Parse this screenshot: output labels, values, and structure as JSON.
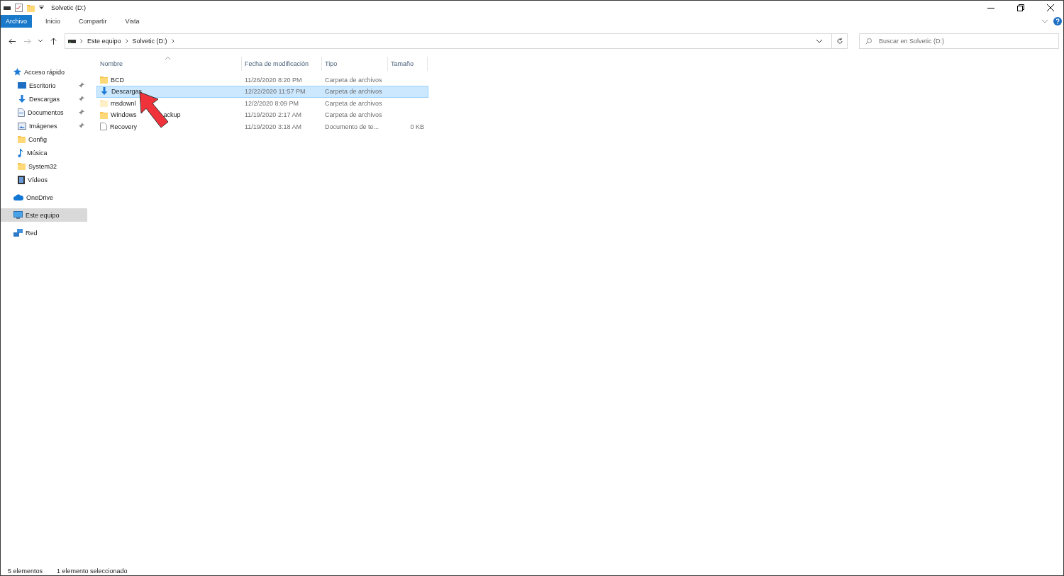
{
  "window": {
    "title": "Solvetic (D:)"
  },
  "ribbon_tabs": [
    {
      "label": "Archivo",
      "selected": true
    },
    {
      "label": "Inicio",
      "selected": false
    },
    {
      "label": "Compartir",
      "selected": false
    },
    {
      "label": "Vista",
      "selected": false
    }
  ],
  "address": {
    "path": [
      "Este equipo",
      "Solvetic (D:)"
    ]
  },
  "search": {
    "placeholder": "Buscar en Solvetic (D:)"
  },
  "sidebar": {
    "items": [
      {
        "label": "Acceso rápido",
        "selected": false,
        "children": [
          {
            "label": "Escritorio",
            "pinned": true
          },
          {
            "label": "Descargas",
            "pinned": true
          },
          {
            "label": "Documentos",
            "pinned": true
          },
          {
            "label": "Imágenes",
            "pinned": true
          },
          {
            "label": "Config",
            "pinned": false
          },
          {
            "label": "Música",
            "pinned": false
          },
          {
            "label": "System32",
            "pinned": false
          },
          {
            "label": "Vídeos",
            "pinned": false
          }
        ]
      },
      {
        "label": "OneDrive",
        "selected": false
      },
      {
        "label": "Este equipo",
        "selected": true
      },
      {
        "label": "Red",
        "selected": false
      }
    ]
  },
  "table": {
    "columns": [
      "Nombre",
      "Fecha de modificación",
      "Tipo",
      "Tamaño"
    ],
    "rows": [
      {
        "kind": "folder",
        "name": "BCD",
        "date": "11/26/2020 8:20 PM",
        "type": "Carpeta de archivos",
        "selected": false,
        "hidden": false
      },
      {
        "kind": "downloads",
        "name": "Descargas",
        "date": "12/22/2020 11:57 PM",
        "type": "Carpeta de archivos",
        "selected": true,
        "hidden": false
      },
      {
        "kind": "folder",
        "name": "msdownl",
        "date": "12/2/2020 8:09 PM",
        "type": "Carpeta de archivos",
        "selected": false,
        "hidden": true
      },
      {
        "kind": "folder",
        "name": "Windows",
        "name_tail": "ackup",
        "date": "11/19/2020 2:17 AM",
        "type": "Carpeta de archivos",
        "selected": false,
        "hidden": false
      },
      {
        "kind": "file",
        "name": "Recovery",
        "date": "11/19/2020 3:18 AM",
        "type": "Documento de te...",
        "size": "0 KB",
        "selected": false,
        "hidden": false
      }
    ]
  },
  "status_bar": {
    "count": "5 elementos",
    "selection": "1 elemento seleccionado"
  }
}
